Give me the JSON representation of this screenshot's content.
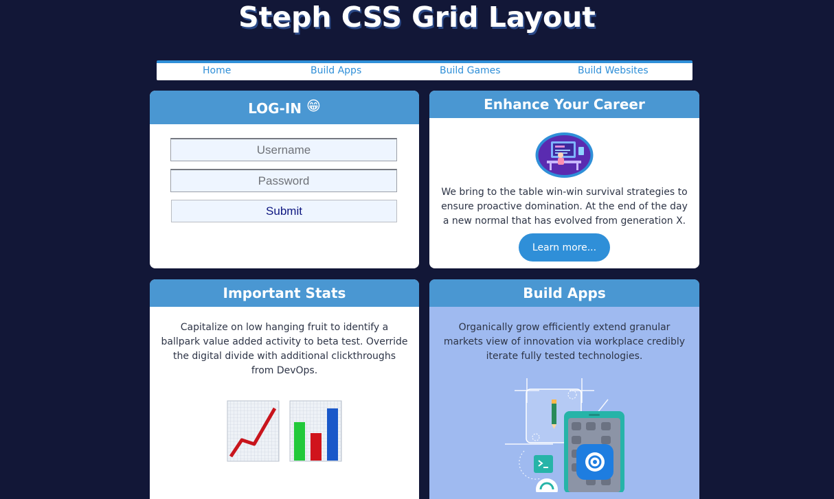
{
  "header": {
    "title": "Steph CSS Grid Layout"
  },
  "nav": {
    "items": [
      {
        "label": "Home"
      },
      {
        "label": "Build Apps"
      },
      {
        "label": "Build Games"
      },
      {
        "label": "Build Websites"
      }
    ]
  },
  "login": {
    "title": "LOG-IN",
    "emoji": "😁",
    "username_placeholder": "Username",
    "password_placeholder": "Password",
    "submit_label": "Submit"
  },
  "career": {
    "title": "Enhance Your Career",
    "icon": "developer-workstation-illustration",
    "text": "We bring to the table win-win survival strategies to ensure proactive domination. At the end of the day a new normal that has evolved from generation X.",
    "button_label": "Learn more..."
  },
  "stats": {
    "title": "Important Stats",
    "text": "Capitalize on low hanging fruit to identify a ballpark value added activity to beta test. Override the digital divide with additional clickthroughs from DevOps.",
    "icons": [
      "chart-increasing-icon",
      "bar-chart-icon"
    ]
  },
  "apps": {
    "title": "Build Apps",
    "text": "Organically grow efficiently extend granular markets view of innovation via workplace credibly iterate fully tested technologies.",
    "illustration": "mobile-app-development-illustration"
  },
  "colors": {
    "background": "#121737",
    "header_blue": "#4a97d2",
    "accent": "#2f8fd8",
    "apps_panel": "#9fbaf0"
  }
}
